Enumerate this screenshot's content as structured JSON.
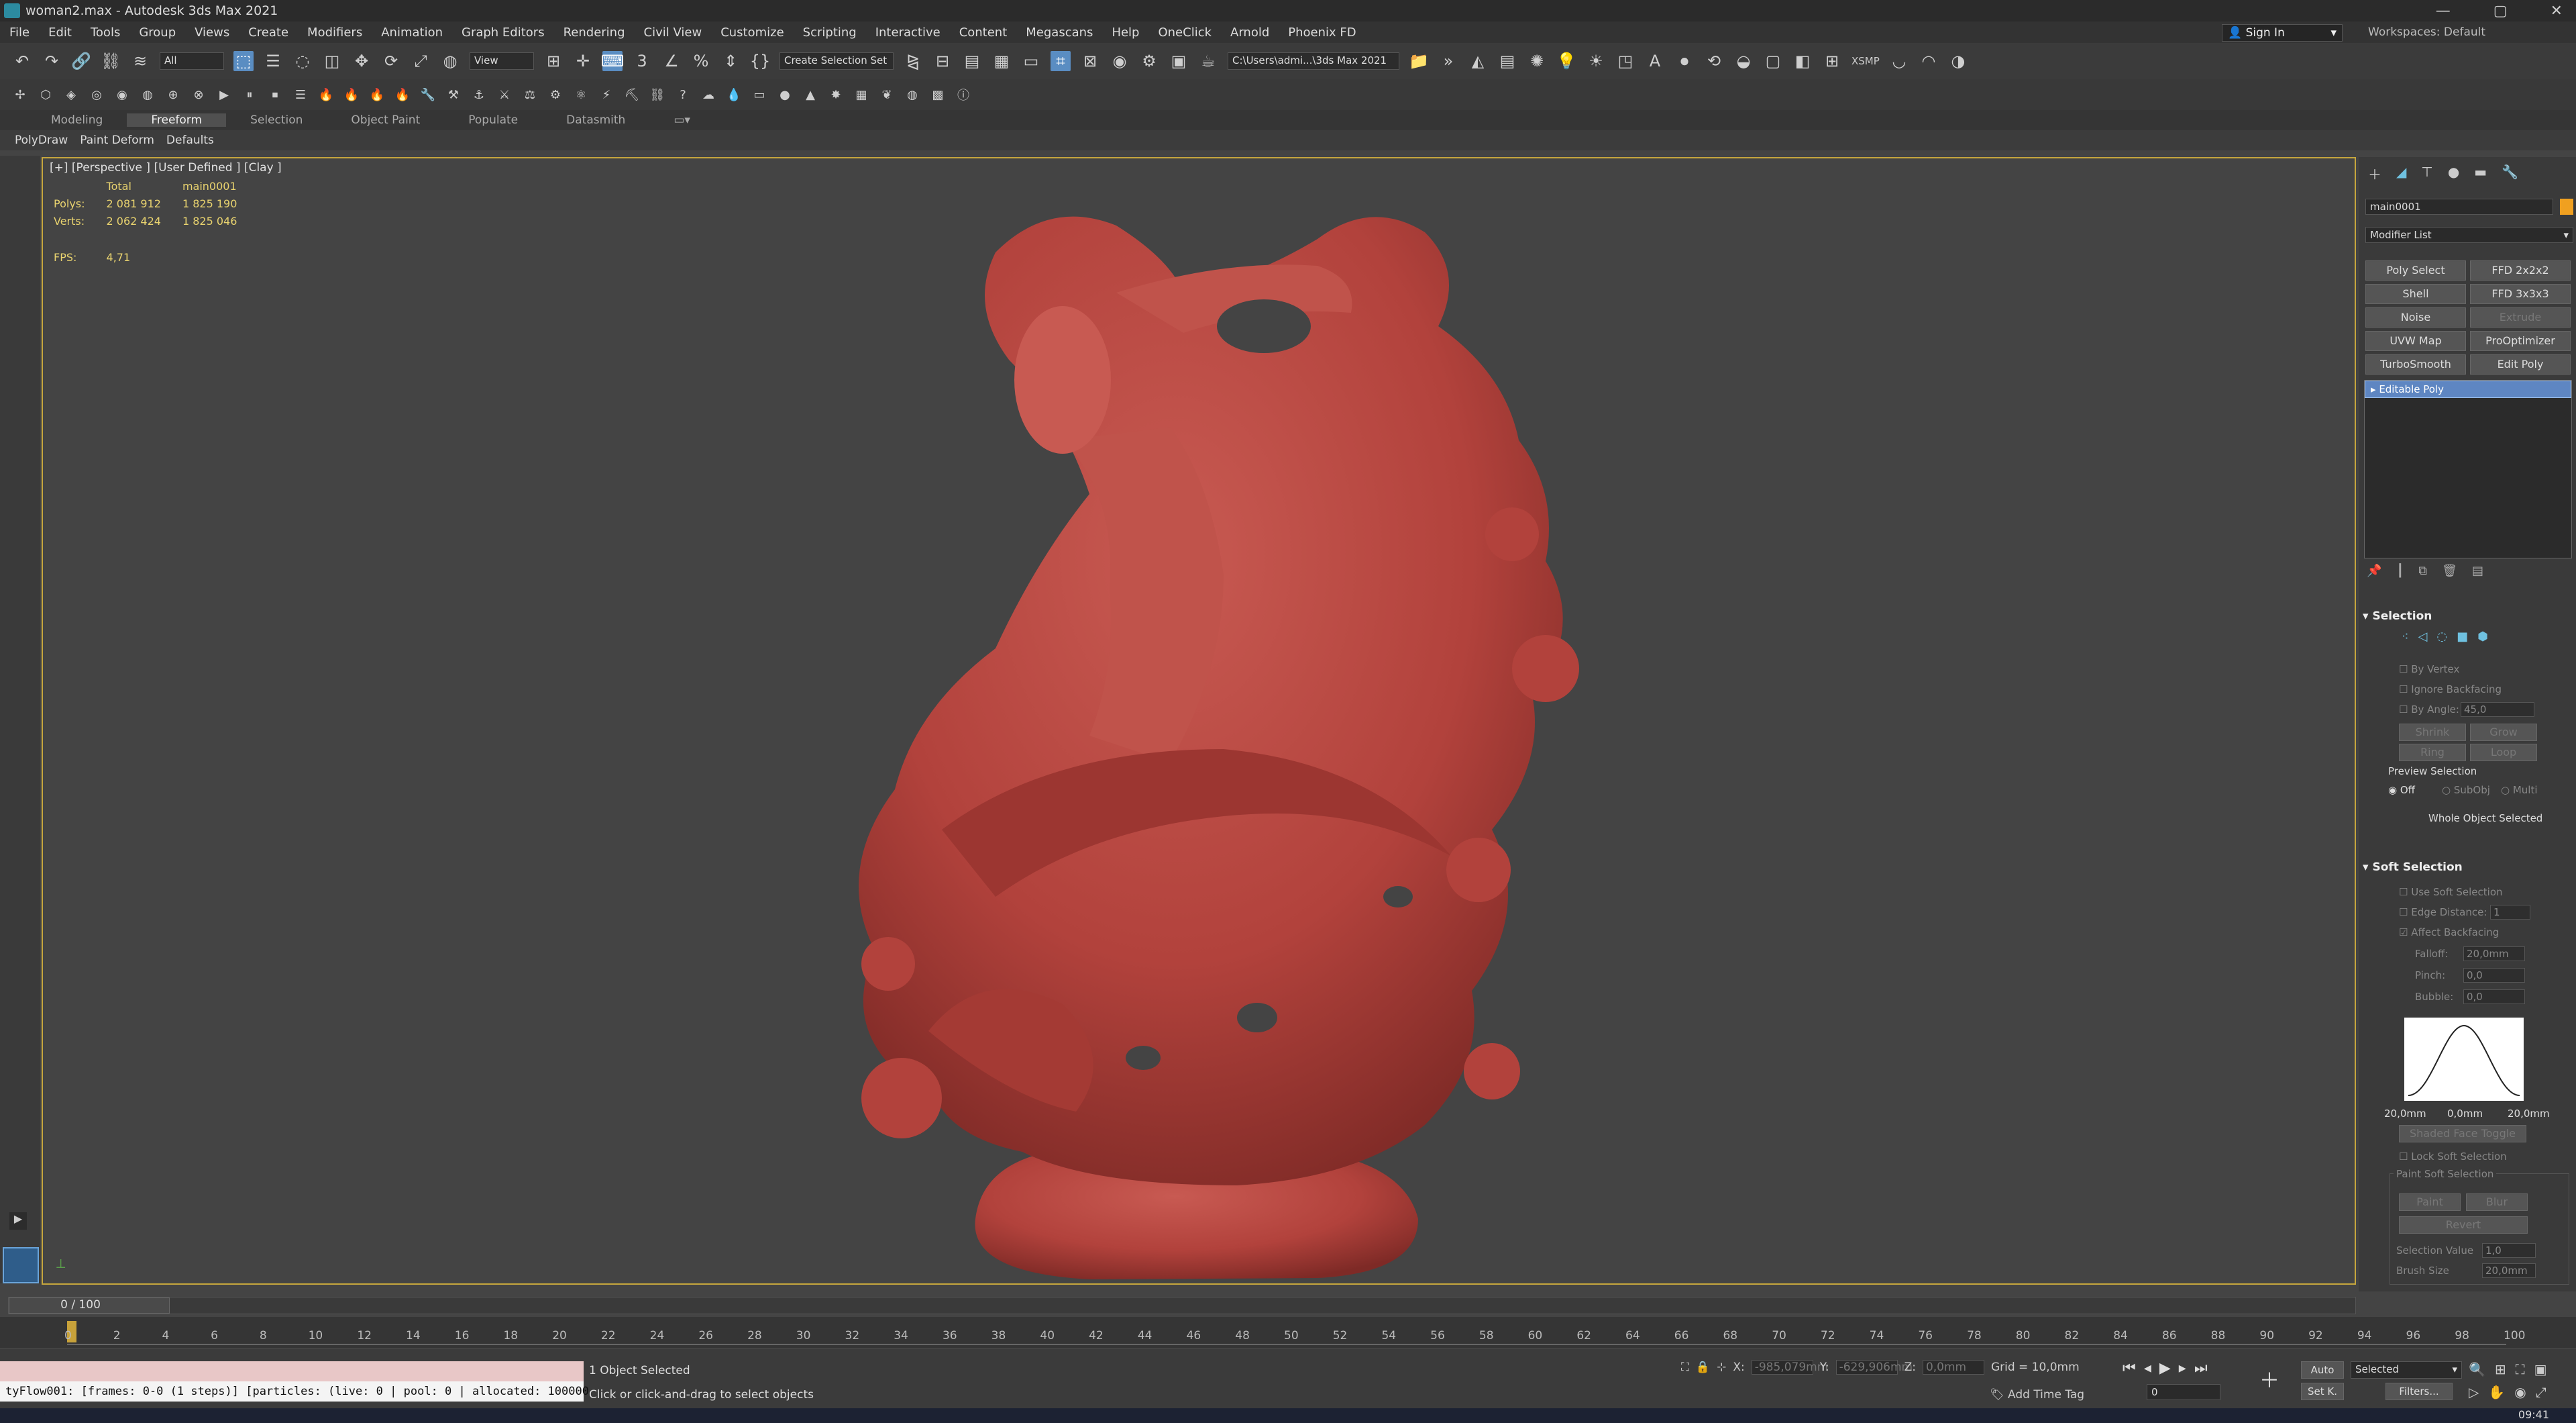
{
  "window": {
    "title": "woman2.max - Autodesk 3ds Max 2021",
    "controls": [
      "—",
      "▢",
      "✕"
    ]
  },
  "menu": [
    "File",
    "Edit",
    "Tools",
    "Group",
    "Views",
    "Create",
    "Modifiers",
    "Animation",
    "Graph Editors",
    "Rendering",
    "Civil View",
    "Customize",
    "Scripting",
    "Interactive",
    "Content",
    "Megascans",
    "Help",
    "OneClick",
    "Arnold",
    "Phoenix FD"
  ],
  "account": {
    "signin": "Sign In",
    "workspace_label": "Workspaces: Default"
  },
  "toolbar": {
    "filter": "All",
    "refcoord": "View",
    "selection_set": "Create Selection Set",
    "project_path": "C:\\Users\\admi...\\3ds Max 2021",
    "xsmp": "XSMP"
  },
  "ribbon": {
    "tabs": [
      "Modeling",
      "Freeform",
      "Selection",
      "Object Paint",
      "Populate",
      "Datasmith"
    ],
    "active": "Freeform",
    "subtabs": [
      "PolyDraw",
      "Paint Deform",
      "Defaults"
    ]
  },
  "viewport": {
    "label": "[+] [Perspective ] [User Defined ] [Clay ]",
    "stats": {
      "col1": "Total",
      "col2": "main0001",
      "polys_label": "Polys:",
      "polys_total": "2 081 912",
      "polys_obj": "1 825 190",
      "verts_label": "Verts:",
      "verts_total": "2 062 424",
      "verts_obj": "1 825 046",
      "fps_label": "FPS:",
      "fps": "4,71"
    },
    "model_color": "#b2423c"
  },
  "cmdpanel": {
    "object_name": "main0001",
    "modifier_list": "Modifier List",
    "buttons": [
      "Poly Select",
      "FFD 2x2x2",
      "Shell",
      "FFD 3x3x3",
      "Noise",
      "Extrude",
      "UVW Map",
      "ProOptimizer",
      "TurboSmooth",
      "Edit Poly"
    ],
    "stack_item": "Editable Poly",
    "selection": {
      "title": "Selection",
      "by_vertex": "By Vertex",
      "ignore_backfacing": "Ignore Backfacing",
      "by_angle": "By Angle:",
      "angle": "45,0",
      "shrink": "Shrink",
      "grow": "Grow",
      "ring": "Ring",
      "loop": "Loop",
      "preview": "Preview Selection",
      "off": "Off",
      "subobj": "SubObj",
      "multi": "Multi",
      "status": "Whole Object Selected"
    },
    "soft": {
      "title": "Soft Selection",
      "use": "Use Soft Selection",
      "edge_distance": "Edge Distance:",
      "edge_value": "1",
      "affect_back": "Affect Backfacing",
      "falloff": "Falloff:",
      "falloff_v": "20,0mm",
      "pinch": "Pinch:",
      "pinch_v": "0,0",
      "bubble": "Bubble:",
      "bubble_v": "0,0",
      "curve_left": "20,0mm",
      "curve_mid": "0,0mm",
      "curve_right": "20,0mm",
      "shaded": "Shaded Face Toggle",
      "lock": "Lock Soft Selection",
      "paint_title": "Paint Soft Selection",
      "paint": "Paint",
      "blur": "Blur",
      "revert": "Revert",
      "sel_value": "Selection Value",
      "sel_value_v": "1,0",
      "brush": "Brush Size",
      "brush_v": "20,0mm"
    }
  },
  "timeline": {
    "slider": "0 / 100",
    "ticks": [
      "0",
      "2",
      "4",
      "6",
      "8",
      "10",
      "12",
      "14",
      "16",
      "18",
      "20",
      "22",
      "24",
      "26",
      "28",
      "30",
      "32",
      "34",
      "36",
      "38",
      "40",
      "42",
      "44",
      "46",
      "48",
      "50",
      "52",
      "54",
      "56",
      "58",
      "60",
      "62",
      "64",
      "66",
      "68",
      "70",
      "72",
      "74",
      "76",
      "78",
      "80",
      "82",
      "84",
      "86",
      "88",
      "90",
      "92",
      "94",
      "96",
      "98",
      "100"
    ]
  },
  "status": {
    "listener": "tyFlow001: [frames: 0-0 (1 steps)] [particles: (live: 0 | pool: 0 | allocated: 100000",
    "selected": "1 Object Selected",
    "prompt": "Click or click-and-drag to select objects",
    "x_label": "X:",
    "x": "-985,079mm",
    "y_label": "Y:",
    "y": "-629,906mm",
    "z_label": "Z:",
    "z": "0,0mm",
    "grid": "Grid = 10,0mm",
    "add_time_tag": "Add Time Tag",
    "auto": "Auto",
    "selected_dd": "Selected",
    "setk": "Set K.",
    "filters": "Filters...",
    "frame": "0",
    "time": "09:41"
  }
}
